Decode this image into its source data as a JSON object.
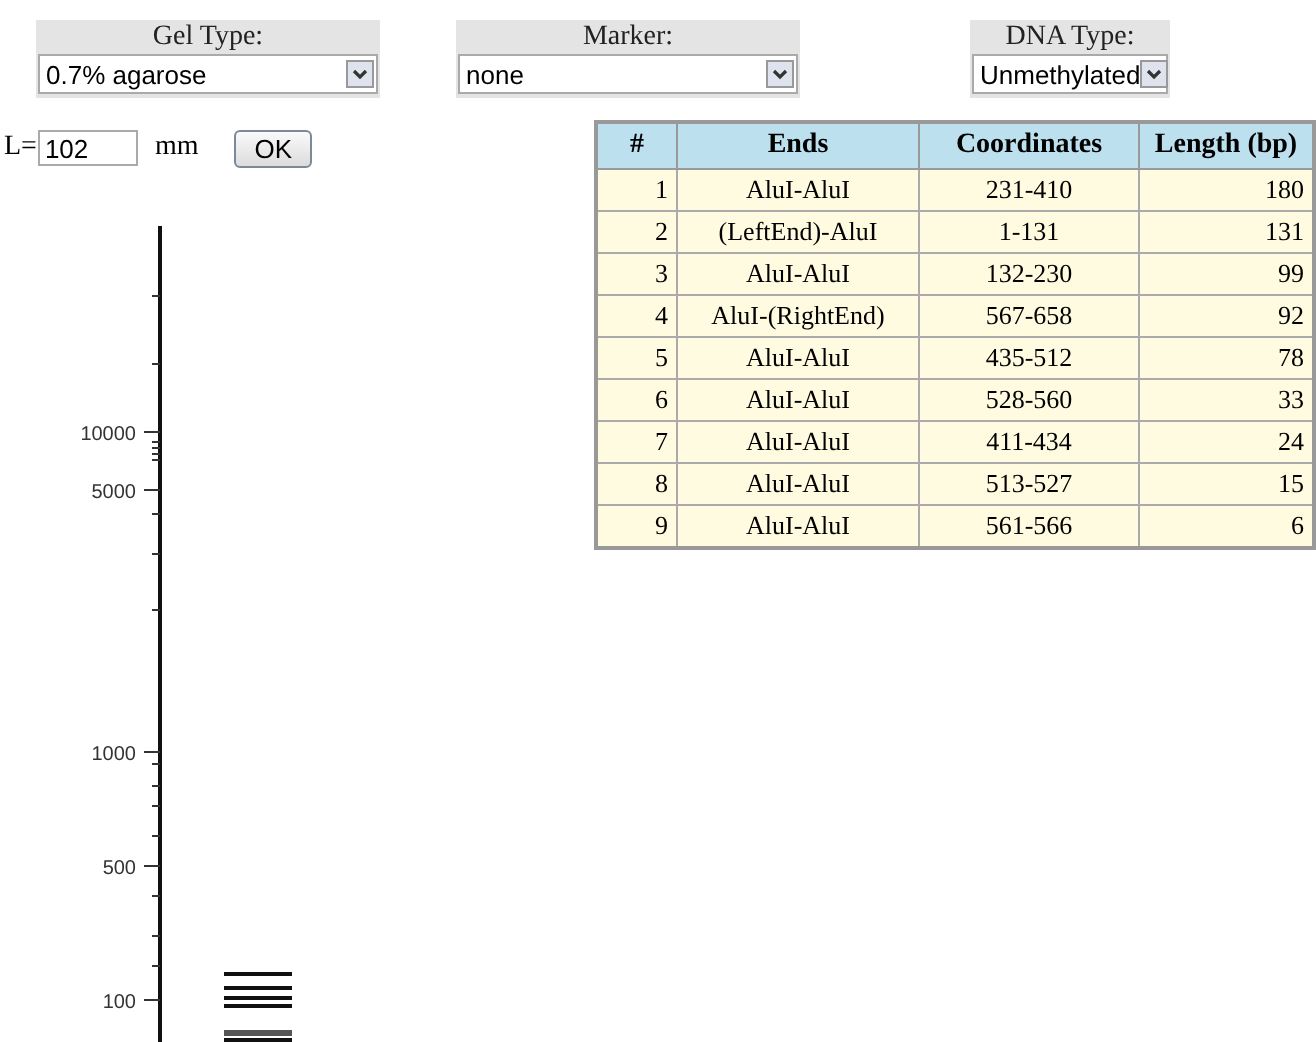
{
  "selectors": [
    {
      "label": "Gel Type:",
      "value": "0.7% agarose"
    },
    {
      "label": "Marker:",
      "value": "none"
    },
    {
      "label": "DNA Type:",
      "value": "Unmethylated"
    }
  ],
  "length_field": {
    "label": "L=",
    "value": "102",
    "unit": "mm"
  },
  "ok_button": "OK",
  "gel": {
    "ladder_labels": [
      "10000",
      "5000",
      "1000",
      "500",
      "100"
    ]
  },
  "table": {
    "columns": [
      "#",
      "Ends",
      "Coordinates",
      "Length (bp)"
    ],
    "rows": [
      [
        "1",
        "AluI-AluI",
        "231-410",
        "180"
      ],
      [
        "2",
        "(LeftEnd)-AluI",
        "1-131",
        "131"
      ],
      [
        "3",
        "AluI-AluI",
        "132-230",
        "99"
      ],
      [
        "4",
        "AluI-(RightEnd)",
        "567-658",
        "92"
      ],
      [
        "5",
        "AluI-AluI",
        "435-512",
        "78"
      ],
      [
        "6",
        "AluI-AluI",
        "528-560",
        "33"
      ],
      [
        "7",
        "AluI-AluI",
        "411-434",
        "24"
      ],
      [
        "8",
        "AluI-AluI",
        "513-527",
        "15"
      ],
      [
        "9",
        "AluI-AluI",
        "561-566",
        "6"
      ]
    ]
  }
}
